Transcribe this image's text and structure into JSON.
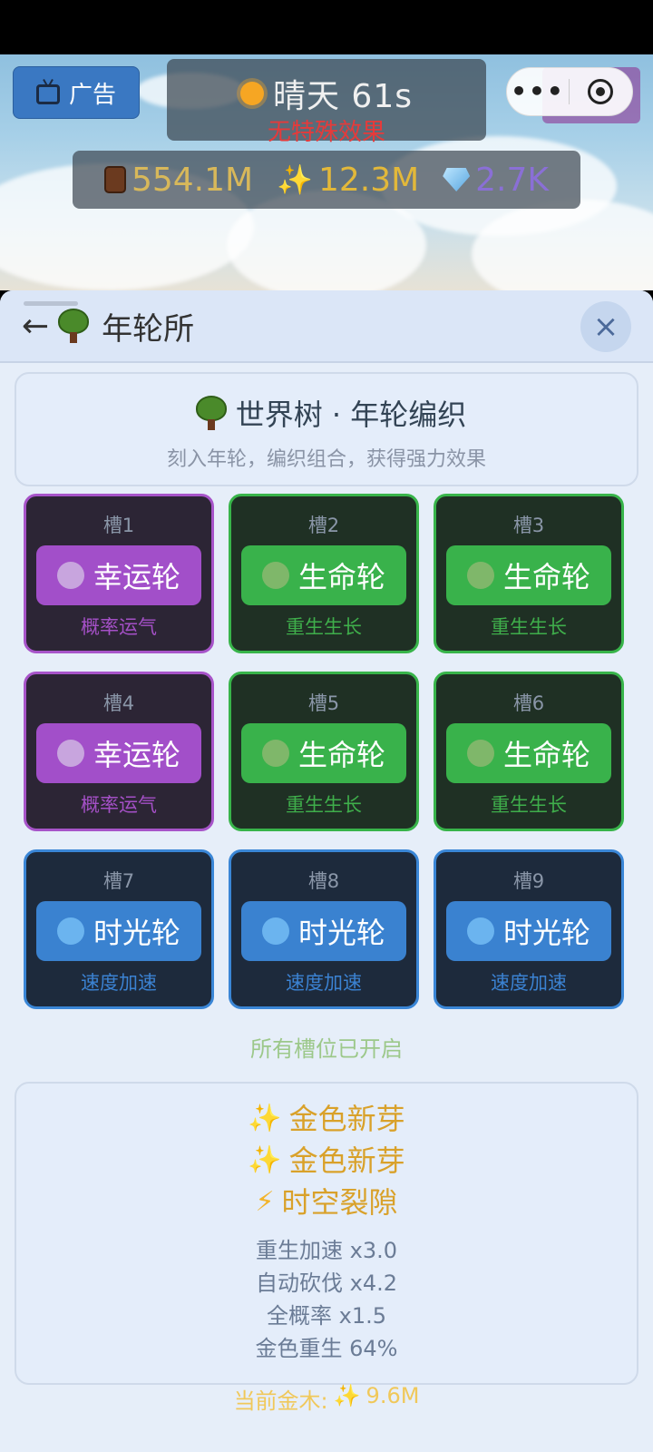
{
  "status_bar": {},
  "ad_button": {
    "label": "广告",
    "icon": "tv-icon"
  },
  "weather": {
    "text": "晴天 61s",
    "effect": "无特殊效果",
    "icon": "sun-icon"
  },
  "resources": [
    {
      "icon": "wood-icon",
      "value": "554.1M",
      "color": "#d8b85a"
    },
    {
      "icon": "sparkle-icon",
      "value": "12.3M",
      "color": "#e2b83a"
    },
    {
      "icon": "diamond-icon",
      "value": "2.7K",
      "color": "#8a6fd6"
    }
  ],
  "capsule": {
    "more": "•••",
    "close": "target-icon"
  },
  "header": {
    "back": "←",
    "title": "年轮所",
    "close": "×"
  },
  "intro": {
    "title": "世界树 · 年轮编织",
    "subtitle": "刻入年轮，编织组合，获得强力效果"
  },
  "slots": [
    {
      "label": "槽1",
      "name": "幸运轮",
      "desc": "概率运气",
      "variant": "purple"
    },
    {
      "label": "槽2",
      "name": "生命轮",
      "desc": "重生生长",
      "variant": "green"
    },
    {
      "label": "槽3",
      "name": "生命轮",
      "desc": "重生生长",
      "variant": "green"
    },
    {
      "label": "槽4",
      "name": "幸运轮",
      "desc": "概率运气",
      "variant": "purple"
    },
    {
      "label": "槽5",
      "name": "生命轮",
      "desc": "重生生长",
      "variant": "green"
    },
    {
      "label": "槽6",
      "name": "生命轮",
      "desc": "重生生长",
      "variant": "green"
    },
    {
      "label": "槽7",
      "name": "时光轮",
      "desc": "速度加速",
      "variant": "blue"
    },
    {
      "label": "槽8",
      "name": "时光轮",
      "desc": "速度加速",
      "variant": "blue"
    },
    {
      "label": "槽9",
      "name": "时光轮",
      "desc": "速度加速",
      "variant": "blue"
    }
  ],
  "all_open": "所有槽位已开启",
  "combos": [
    {
      "glyph": "✨",
      "text": "金色新芽"
    },
    {
      "glyph": "✨",
      "text": "金色新芽"
    },
    {
      "glyph": "⚡",
      "text": "时空裂隙"
    }
  ],
  "stats": [
    "重生加速 x3.0",
    "自动砍伐 x4.2",
    "全概率 x1.5",
    "金色重生 64%"
  ],
  "current_gold": {
    "label": "当前金木:",
    "glyph": "✨",
    "value": "9.6M"
  }
}
